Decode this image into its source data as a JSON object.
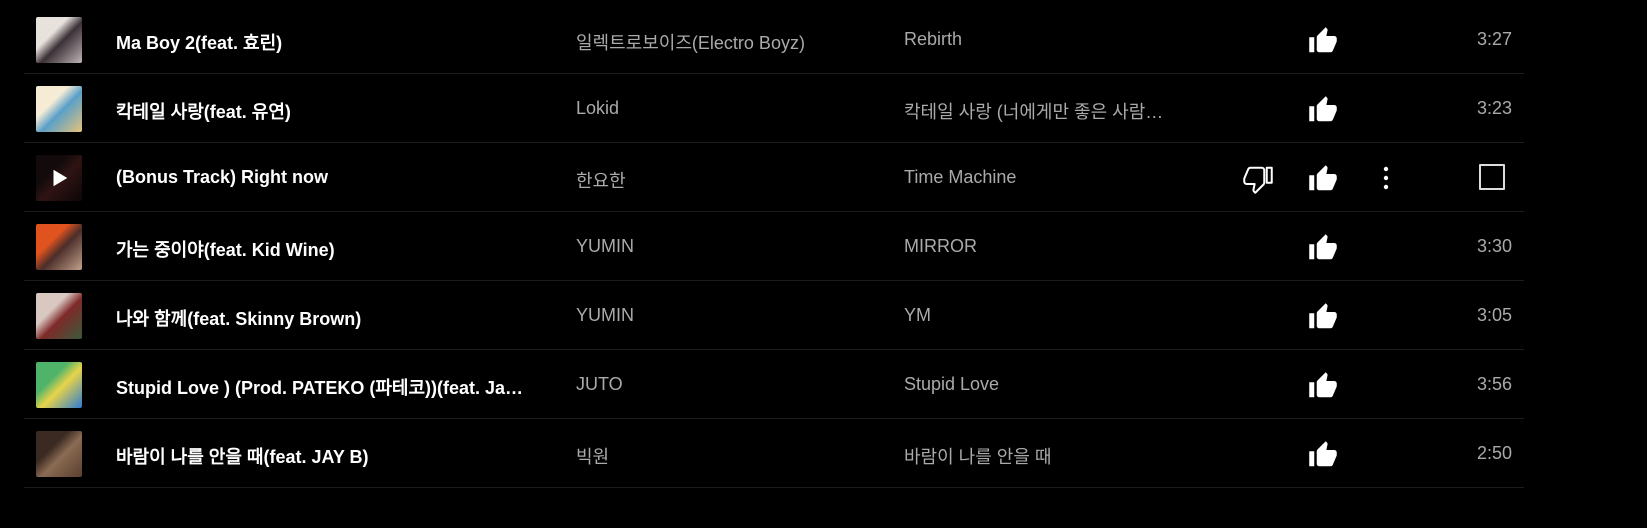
{
  "tracks": [
    {
      "title": "Ma Boy 2(feat. 효린)",
      "artist": "일렉트로보이즈(Electro Boyz)",
      "album": "Rebirth",
      "duration": "3:27",
      "thumb_colors": [
        "#e8e2dd",
        "#3a3036",
        "#bfb4b5"
      ],
      "hovered": false
    },
    {
      "title": "칵테일 사랑(feat. 유연)",
      "artist": "Lokid",
      "album": "칵테일 사랑 (너에게만 좋은 사람…",
      "duration": "3:23",
      "thumb_colors": [
        "#f6ecd6",
        "#5aa0c8",
        "#e8c27a"
      ],
      "hovered": false
    },
    {
      "title": "(Bonus Track) Right now",
      "artist": "한요한",
      "album": "Time Machine",
      "duration": "",
      "thumb_colors": [
        "#2b1a1a",
        "#6a2b2b",
        "#1b1010"
      ],
      "hovered": true
    },
    {
      "title": "가는 중이야(feat. Kid Wine)",
      "artist": "YUMIN",
      "album": "MIRROR",
      "duration": "3:30",
      "thumb_colors": [
        "#e0531f",
        "#4b2e2a",
        "#c2a08a"
      ],
      "hovered": false
    },
    {
      "title": "나와 함께(feat. Skinny Brown)",
      "artist": "YUMIN",
      "album": "YM",
      "duration": "3:05",
      "thumb_colors": [
        "#d9c8c2",
        "#7f2a2a",
        "#3a5a3a"
      ],
      "hovered": false
    },
    {
      "title": "Stupid Love ) (Prod. PATEKO (파테코))(feat. Ja…",
      "artist": "JUTO",
      "album": "Stupid Love",
      "duration": "3:56",
      "thumb_colors": [
        "#4fb46a",
        "#e8d34a",
        "#2e7bd1"
      ],
      "hovered": false
    },
    {
      "title": "바람이 나를 안을 때(feat. JAY B)",
      "artist": "빅원",
      "album": "바람이 나를 안을 때",
      "duration": "2:50",
      "thumb_colors": [
        "#3a2a22",
        "#8a6a52",
        "#5a4030"
      ],
      "hovered": false
    }
  ],
  "icons": {
    "like": "thumb-up-icon",
    "dislike": "thumb-down-icon",
    "menu": "more-vert-icon",
    "play": "play-icon"
  },
  "colors": {
    "background": "#000000",
    "title": "#ffffff",
    "secondary": "#aaaaaa",
    "divider": "#1c1c1c"
  }
}
